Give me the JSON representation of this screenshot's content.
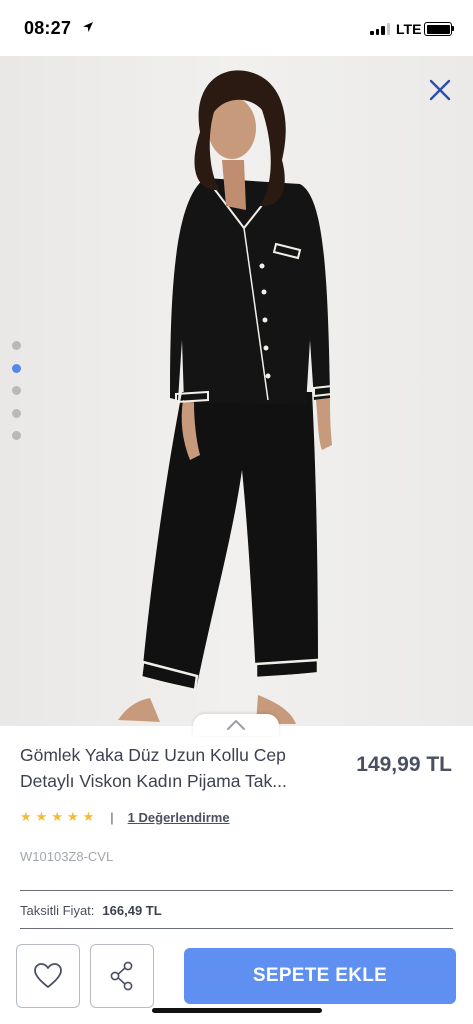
{
  "status_bar": {
    "time": "08:27",
    "network": "LTE"
  },
  "product": {
    "title_line1": "Gömlek Yaka Düz Uzun Kollu Cep",
    "title_line2": "Detaylı Viskon Kadın Pijama Tak...",
    "price": "149,99 TL",
    "rating_stars": 5,
    "separator": "|",
    "review_link": "1 Değerlendirme",
    "sku": "W10103Z8-CVL",
    "installment_label": "Taksitli Fiyat:",
    "installment_value": "166,49 TL"
  },
  "gallery": {
    "image_count": 5,
    "active_index": 1
  },
  "actions": {
    "add_to_cart": "SEPETE EKLE"
  },
  "icons": {
    "close": "close-icon",
    "favorite": "heart-icon",
    "share": "share-icon",
    "expand": "chevron-up-icon",
    "location": "location-arrow-icon"
  },
  "colors": {
    "accent": "#5f8ff0",
    "close_icon": "#2c4fae",
    "star": "#f5b93b",
    "active_dot": "#5a86e8"
  }
}
